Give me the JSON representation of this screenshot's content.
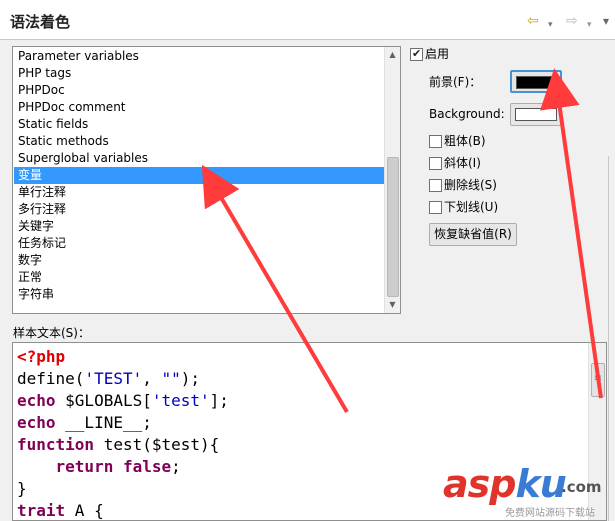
{
  "header": {
    "title": "语法着色",
    "back_icon": "⇦",
    "forward_icon": "⇨",
    "dropdown_icon": "▾",
    "more_icon": "▾"
  },
  "element_list": {
    "items": [
      "Parameter variables",
      "PHP tags",
      "PHPDoc",
      "PHPDoc comment",
      "Static fields",
      "Static methods",
      "Superglobal variables",
      "变量",
      "单行注释",
      "多行注释",
      "关键字",
      "任务标记",
      "数字",
      "正常",
      "字符串"
    ],
    "selected": "变量"
  },
  "options": {
    "enable_label": "启用",
    "enable_checked": true,
    "foreground_label": "前景(F)：",
    "foreground_color": "#000000",
    "background_label": "Background:",
    "background_color": "#ffffff",
    "bold_label": "粗体(B)",
    "italic_label": "斜体(I)",
    "strike_label": "删除线(S)",
    "underline_label": "下划线(U)",
    "restore_label": "恢复缺省值(R)"
  },
  "preview": {
    "label": "样本文本(S)：",
    "lines": [
      [
        {
          "t": "<?php",
          "c": "php"
        }
      ],
      [
        {
          "t": "define(",
          "c": "plain"
        },
        {
          "t": "'TEST'",
          "c": "str"
        },
        {
          "t": ", ",
          "c": "plain"
        },
        {
          "t": "\"\"",
          "c": "str"
        },
        {
          "t": ");",
          "c": "plain"
        }
      ],
      [
        {
          "t": "echo",
          "c": "kw"
        },
        {
          "t": " $GLOBALS[",
          "c": "plain"
        },
        {
          "t": "'test'",
          "c": "str"
        },
        {
          "t": "];",
          "c": "plain"
        }
      ],
      [
        {
          "t": "echo",
          "c": "kw"
        },
        {
          "t": " __LINE__;",
          "c": "plain"
        }
      ],
      [
        {
          "t": "function",
          "c": "kw"
        },
        {
          "t": " test($test){",
          "c": "plain"
        }
      ],
      [
        {
          "t": "    ",
          "c": "plain"
        },
        {
          "t": "return",
          "c": "kw"
        },
        {
          "t": " ",
          "c": "plain"
        },
        {
          "t": "false",
          "c": "kw"
        },
        {
          "t": ";",
          "c": "plain"
        }
      ],
      [
        {
          "t": "}",
          "c": "plain"
        }
      ],
      [
        {
          "t": "trait",
          "c": "kw"
        },
        {
          "t": " A {",
          "c": "plain"
        }
      ]
    ]
  },
  "watermark": {
    "logo": "asp",
    "logo_ku": "ku",
    "domain": ".com",
    "subtitle": "免费网站源码下载站"
  },
  "colors": {
    "selection": "#3399ff",
    "annotation_arrow": "#ff3b3b"
  }
}
